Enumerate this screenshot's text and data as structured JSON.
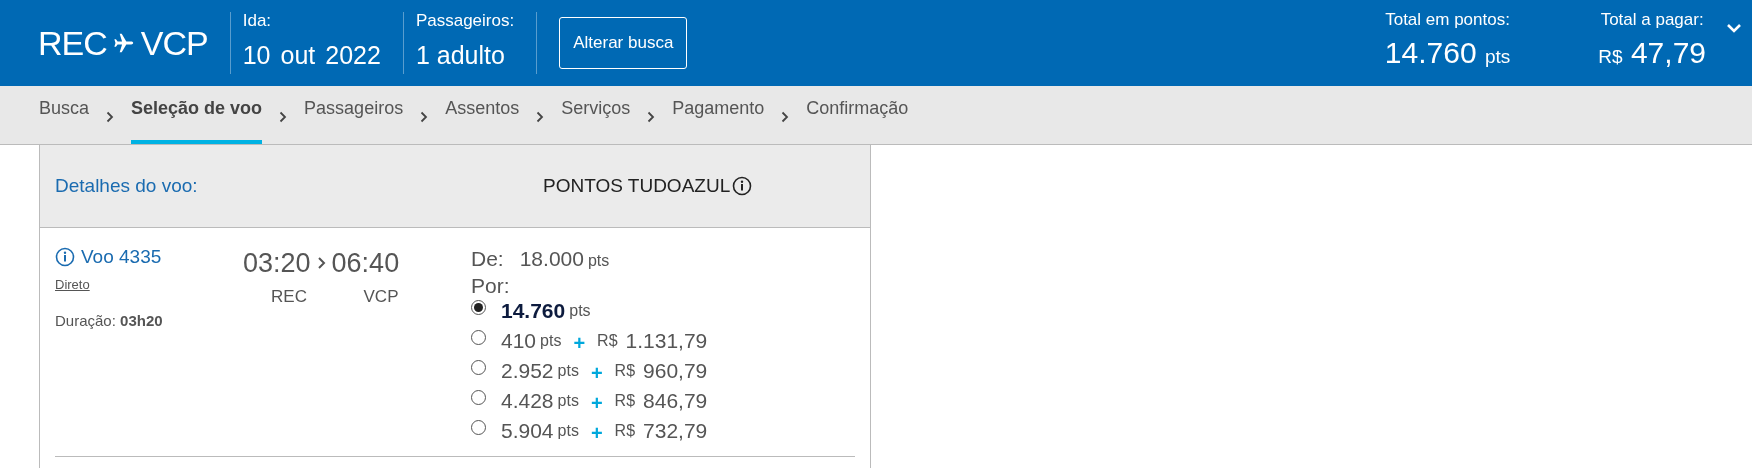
{
  "header": {
    "origin": "REC",
    "destination": "VCP",
    "date_label": "Ida:",
    "date_parts": [
      "10",
      "out",
      "2022"
    ],
    "passengers_label": "Passageiros:",
    "passengers": "1 adulto",
    "change_button": "Alterar busca",
    "points_total_label": "Total em pontos:",
    "points_total": "14.760",
    "points_unit": "pts",
    "pay_label": "Total a pagar:",
    "currency": "R$",
    "pay_total": "47,79"
  },
  "steps": [
    {
      "label": "Busca",
      "selected": false
    },
    {
      "label": "Seleção de voo",
      "selected": true
    },
    {
      "label": "Passageiros",
      "selected": false
    },
    {
      "label": "Assentos",
      "selected": false
    },
    {
      "label": "Serviços",
      "selected": false
    },
    {
      "label": "Pagamento",
      "selected": false
    },
    {
      "label": "Confirmação",
      "selected": false
    }
  ],
  "flight": {
    "details_label": "Detalhes do voo:",
    "fare_column": "PONTOS TUDOAZUL",
    "number": "Voo 4335",
    "stops": "Direto",
    "duration_label": "Duração:",
    "duration": "03h20",
    "departure_time": "03:20",
    "arrival_time": "06:40",
    "departure_airport": "REC",
    "arrival_airport": "VCP",
    "from_label": "De:",
    "original_points": "18.000",
    "original_unit": "pts",
    "for_label": "Por:",
    "fares": [
      {
        "points": "14.760",
        "unit": "pts",
        "selected": true
      },
      {
        "points": "410",
        "unit": "pts",
        "plus": "+",
        "currency": "R$",
        "amount": "1.131,79",
        "selected": false
      },
      {
        "points": "2.952",
        "unit": "pts",
        "plus": "+",
        "currency": "R$",
        "amount": "960,79",
        "selected": false
      },
      {
        "points": "4.428",
        "unit": "pts",
        "plus": "+",
        "currency": "R$",
        "amount": "846,79",
        "selected": false
      },
      {
        "points": "5.904",
        "unit": "pts",
        "plus": "+",
        "currency": "R$",
        "amount": "732,79",
        "selected": false
      }
    ]
  }
}
